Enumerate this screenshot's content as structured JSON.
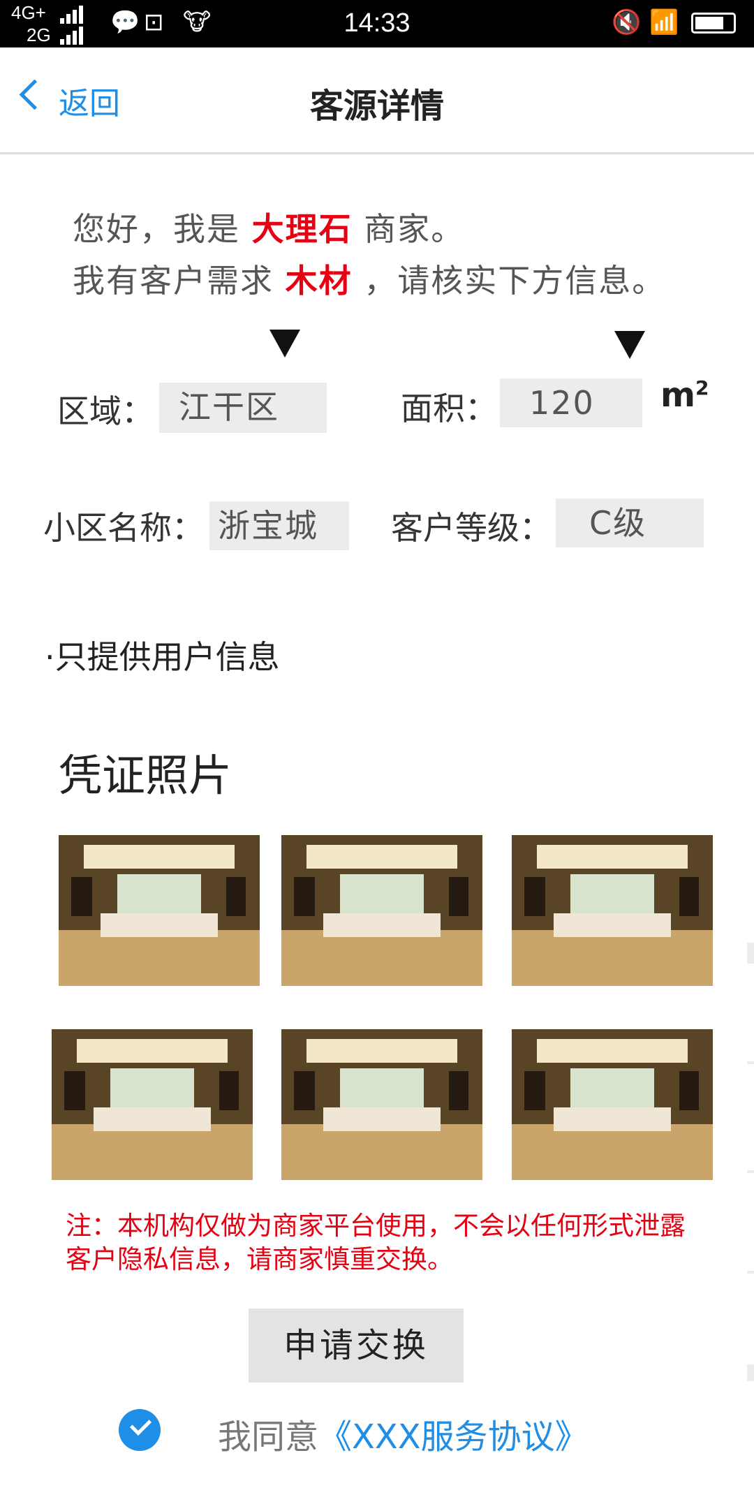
{
  "status_bar": {
    "network_top": "4G+",
    "network_bottom": "2G",
    "time": "14:33"
  },
  "nav": {
    "back_label": "返回",
    "title": "客源详情"
  },
  "intro": {
    "line1_prefix": "您好，我是",
    "merchant_type": "大理石",
    "line1_suffix": "商家。",
    "line2_prefix": "我有客户需求",
    "demand": "木材",
    "line2_suffix": "，请核实下方信息。"
  },
  "fields": {
    "region_label": "区域：",
    "region_value": "江干区",
    "area_label": "面积：",
    "area_value": "120",
    "area_unit": "m",
    "area_unit_sup": "2",
    "community_label": "小区名称：",
    "community_value": "浙宝城",
    "level_label": "客户等级：",
    "level_value": "C级"
  },
  "note": "·只提供用户信息",
  "photos": {
    "title": "凭证照片",
    "count": 6
  },
  "disclaimer": "注：本机构仅做为商家平台使用，不会以任何形式泄露客户隐私信息，请商家慎重交换。",
  "apply_button": "申请交换",
  "agreement": {
    "prefix": "我同意",
    "link": "《XXX服务协议》",
    "checked": true
  },
  "colors": {
    "accent": "#1e8ee6",
    "highlight": "#e60012"
  }
}
